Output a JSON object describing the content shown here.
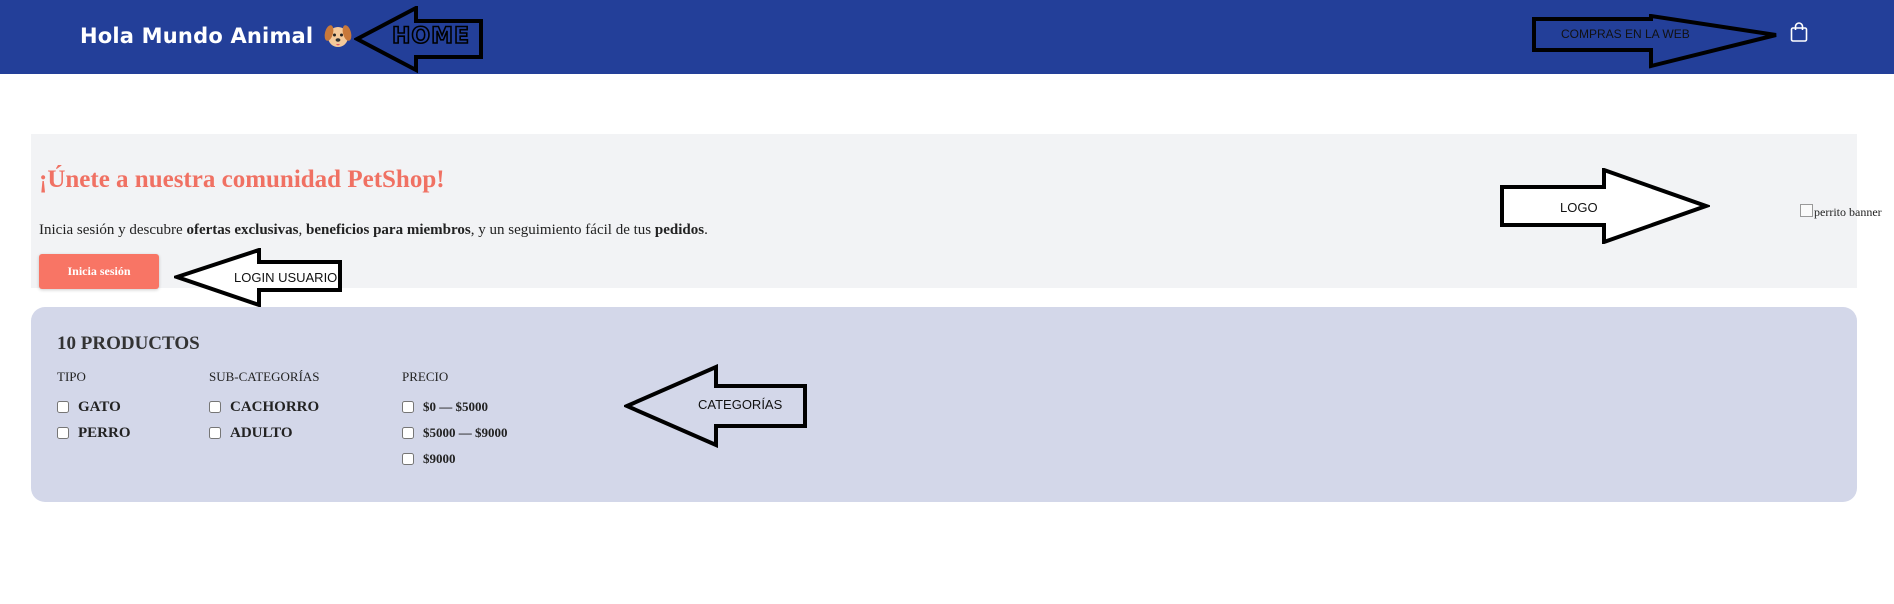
{
  "navbar": {
    "brand": "Hola Mundo Animal",
    "brand_icon": "dog-icon",
    "cart_icon": "shopping-bag-icon",
    "bg_color": "#233f99"
  },
  "annotations": {
    "home": "HOME",
    "compras": "COMPRAS EN LA WEB",
    "logo": "LOGO",
    "login": "LOGIN USUARIO",
    "categorias": "CATEGORÍAS"
  },
  "banner": {
    "title": "¡Únete a nuestra comunidad PetShop!",
    "text_parts": {
      "t1": "Inicia sesión y descubre ",
      "b1": "ofertas exclusivas",
      "t2": ", ",
      "b2": "beneficios para miembros",
      "t3": ", y un seguimiento fácil de tus ",
      "b3": "pedidos",
      "t4": "."
    },
    "login_button": "Inicia sesión",
    "image_alt": "perrito banner",
    "accent_color": "#f87565"
  },
  "filters": {
    "count_label": "10 PRODUCTOS",
    "tipo": {
      "heading": "TIPO",
      "options": [
        "GATO",
        "PERRO"
      ]
    },
    "subcategorias": {
      "heading": "SUB-CATEGORÍAS",
      "options": [
        "CACHORRO",
        "ADULTO"
      ]
    },
    "precio": {
      "heading": "PRECIO",
      "options": [
        "$0 — $5000",
        "$5000 — $9000",
        "$9000"
      ]
    }
  }
}
